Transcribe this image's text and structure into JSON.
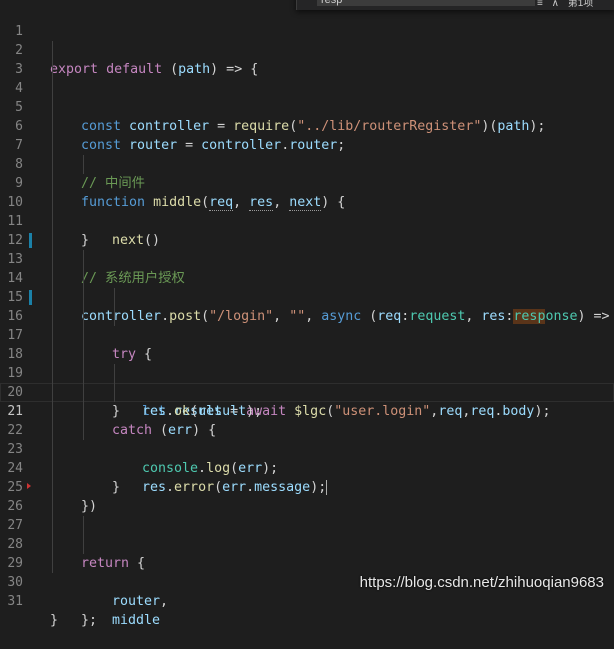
{
  "find": {
    "value": "resp",
    "opt_whole": "≡",
    "opt_regex": "∧",
    "count": "第1项"
  },
  "lines": [
    {
      "n": "1",
      "t": {}
    },
    {
      "n": "2",
      "t": {
        "a": "export",
        "b": "default",
        "c": "(",
        "d": "path",
        "e": ") => {"
      }
    },
    {
      "n": "3",
      "t": {}
    },
    {
      "n": "4",
      "t": {
        "a": "const",
        "b": "controller",
        "c": " = ",
        "d": "require",
        "e": "(",
        "f": "\"../lib/routerRegister\"",
        "g": ")(",
        "h": "path",
        "i": ");"
      }
    },
    {
      "n": "5",
      "t": {
        "a": "const",
        "b": "router",
        "c": " = ",
        "d": "controller",
        "e": ".",
        "f": "router",
        "g": ";"
      }
    },
    {
      "n": "6",
      "t": {}
    },
    {
      "n": "7",
      "t": {
        "a": "// 中间件"
      }
    },
    {
      "n": "8",
      "t": {
        "a": "function",
        "b": "middle",
        "c": "(",
        "d": "req",
        "e": ", ",
        "f": "res",
        "g": ", ",
        "h": "next",
        "i": ") {"
      }
    },
    {
      "n": "9",
      "t": {
        "a": "next",
        "b": "()"
      }
    },
    {
      "n": "10",
      "t": {
        "a": "}"
      }
    },
    {
      "n": "11",
      "t": {}
    },
    {
      "n": "12",
      "t": {
        "a": "// 系统用户授权"
      }
    },
    {
      "n": "13",
      "t": {
        "a": "controller",
        "b": ".",
        "c": "post",
        "d": "(",
        "e": "\"/login\"",
        "f": ", ",
        "g": "\"\"",
        "h": ", ",
        "i": "async",
        "j": " (",
        "k": "req",
        "l": ":",
        "m": "request",
        "n": ", ",
        "o": "res",
        "p": ":",
        "q": "resp",
        "r": "onse",
        "s": ") => {"
      }
    },
    {
      "n": "14",
      "t": {}
    },
    {
      "n": "15",
      "t": {
        "a": "try",
        "b": " {"
      }
    },
    {
      "n": "16",
      "t": {
        "a": "let",
        "b": "result",
        "c": " = ",
        "d": "await",
        "e": "$lgc",
        "f": "(",
        "g": "\"user.login\"",
        "h": ",",
        "i": "req",
        "j": ",",
        "k": "req",
        "l": ".",
        "m": "body",
        "n": ");"
      }
    },
    {
      "n": "17",
      "t": {
        "a": "res",
        "b": ".",
        "c": "ok",
        "d": "(",
        "e": "result",
        "f": ");"
      }
    },
    {
      "n": "18",
      "t": {
        "a": "}"
      }
    },
    {
      "n": "19",
      "t": {
        "a": "catch",
        "b": " (",
        "c": "err",
        "d": ") {"
      }
    },
    {
      "n": "20",
      "t": {
        "a": "console",
        "b": ".",
        "c": "log",
        "d": "(",
        "e": "err",
        "f": ");"
      }
    },
    {
      "n": "21",
      "t": {
        "a": "res",
        "b": ".",
        "c": "error",
        "d": "(",
        "e": "err",
        "f": ".",
        "g": "message",
        "h": ");"
      }
    },
    {
      "n": "22",
      "t": {
        "a": "}"
      }
    },
    {
      "n": "23",
      "t": {}
    },
    {
      "n": "24",
      "t": {
        "a": "})"
      }
    },
    {
      "n": "25",
      "t": {}
    },
    {
      "n": "26",
      "t": {}
    },
    {
      "n": "27",
      "t": {
        "a": "return",
        "b": " {"
      }
    },
    {
      "n": "28",
      "t": {
        "a": "router",
        "b": ","
      }
    },
    {
      "n": "29",
      "t": {
        "a": "middle"
      }
    },
    {
      "n": "30",
      "t": {
        "a": "};"
      }
    },
    {
      "n": "31",
      "t": {
        "a": "}"
      }
    }
  ],
  "watermark": "https://blog.csdn.net/zhihuoqian9683",
  "colors": {
    "background": "#1e1e1e",
    "keyword": "#569cd6",
    "control": "#c586c0",
    "function": "#dcdcaa",
    "variable": "#9cdcfe",
    "string": "#ce9178",
    "comment": "#6a9955",
    "type": "#4ec9b0",
    "find_highlight": "#5a3419",
    "modified_gutter": "#1b81a8"
  }
}
